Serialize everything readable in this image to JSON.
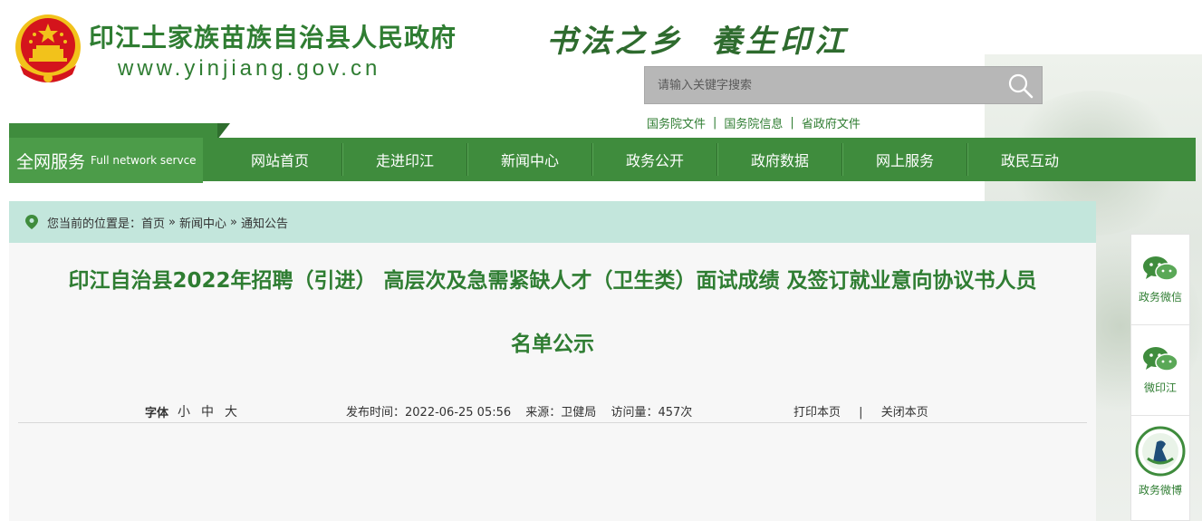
{
  "header": {
    "site_title": "印江土家族苗族自治县人民政府",
    "site_url": "www.yinjiang.gov.cn",
    "slogan_left": "书法之乡",
    "slogan_right": "養生印江",
    "search": {
      "placeholder": "请输入关键字搜索"
    },
    "quick_links": [
      "国务院文件",
      "国务院信息",
      "省政府文件"
    ]
  },
  "nav": {
    "all_service_cn": "全网服务",
    "all_service_en": "Full network servce",
    "items": [
      "网站首页",
      "走进印江",
      "新闻中心",
      "政务公开",
      "政府数据",
      "网上服务",
      "政民互动"
    ]
  },
  "breadcrumb": {
    "prefix": "您当前的位置是：",
    "items": [
      "首页",
      "新闻中心",
      "通知公告"
    ],
    "separator": "»"
  },
  "article": {
    "title_line1": "印江自治县2022年招聘（引进） 高层次及急需紧缺人才（卫生类）面试成绩 及签订就业意向协议书人员",
    "title_line2": "名单公示",
    "font_label": "字体",
    "font_sizes": [
      "小",
      "中",
      "大"
    ],
    "publish_time": "发布时间：2022-06-25 05:56",
    "source": "来源：卫健局",
    "views": "访问量：457次",
    "print": "打印本页",
    "action_sep": "|",
    "close": "关闭本页"
  },
  "side_panel": {
    "items": [
      {
        "label": "政务微信",
        "icon": "wechat-icon"
      },
      {
        "label": "微印江",
        "icon": "wechat-icon"
      },
      {
        "label": "政务微博",
        "icon": "weibo-logo-icon"
      }
    ]
  },
  "colors": {
    "brand_green": "#2f7d32",
    "nav_green": "#3f8c3d",
    "breadcrumb_bg": "#c3e6dc",
    "emblem_red": "#d4141c",
    "emblem_gold": "#f2c21b"
  }
}
